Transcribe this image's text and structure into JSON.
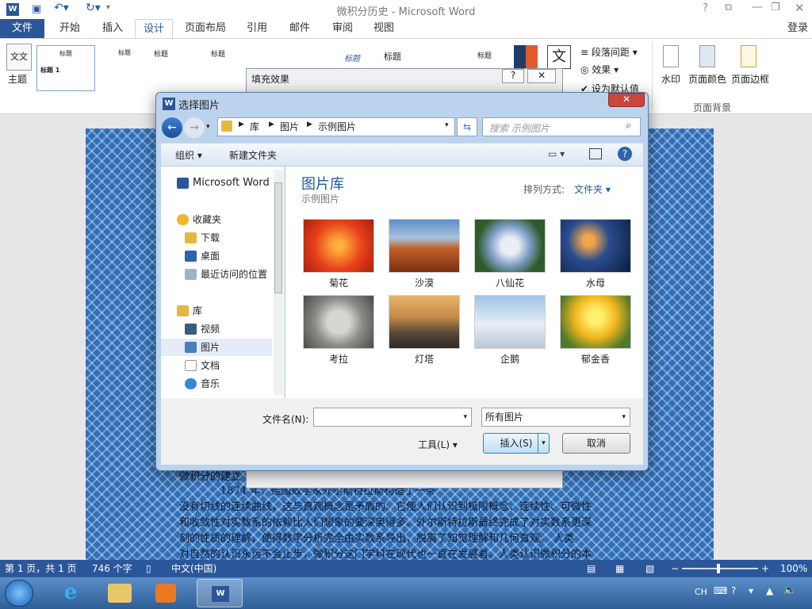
{
  "window": {
    "title": "微积分历史 - Microsoft Word",
    "signin": "登录"
  },
  "tabs": [
    {
      "label": "文件"
    },
    {
      "label": "开始"
    },
    {
      "label": "插入"
    },
    {
      "label": "设计"
    },
    {
      "label": "页面布局"
    },
    {
      "label": "引用"
    },
    {
      "label": "邮件"
    },
    {
      "label": "审阅"
    },
    {
      "label": "视图"
    }
  ],
  "ribbon": {
    "theme_label": "主题",
    "styles": [
      "标题",
      "标题 1",
      "标题",
      "标题",
      "标题",
      "标题",
      "标题",
      "标题"
    ],
    "paragraph_spacing": "段落间距",
    "effects": "效果",
    "set_default": "设为默认值",
    "watermark": "水印",
    "page_color": "页面颜色",
    "page_border": "页面边框",
    "group_page_bg": "页面背景"
  },
  "fill_dialog": {
    "title": "填充效果"
  },
  "dialog": {
    "title": "选择图片",
    "breadcrumb": [
      "库",
      "图片",
      "示例图片"
    ],
    "search_placeholder": "搜索 示例图片",
    "organize": "组织",
    "new_folder": "新建文件夹",
    "library_title": "图片库",
    "library_subtitle": "示例图片",
    "sort_label": "排列方式:",
    "sort_value": "文件夹",
    "nav": {
      "word": "Microsoft Word",
      "favorites": "收藏夹",
      "downloads": "下载",
      "desktop": "桌面",
      "recent": "最近访问的位置",
      "libraries": "库",
      "videos": "视频",
      "pictures": "图片",
      "documents": "文档",
      "music": "音乐"
    },
    "images": [
      {
        "label": "菊花"
      },
      {
        "label": "沙漠"
      },
      {
        "label": "八仙花"
      },
      {
        "label": "水母"
      },
      {
        "label": "考拉"
      },
      {
        "label": "灯塔"
      },
      {
        "label": "企鹅"
      },
      {
        "label": "郁金香"
      }
    ],
    "filename_label": "文件名(N):",
    "filename_value": "",
    "filetype": "所有图片",
    "tools": "工具(L)",
    "insert": "插入(S)",
    "cancel": "取消"
  },
  "doc": {
    "heading": "微积分的建立",
    "lines": [
      "1874 年，德国数学家外尔斯特拉斯构造了一条",
      "没有切线的连续曲线，这与直观概念是矛盾的。它使人们认识到极限概念、连续性、可微性",
      "和收敛性对实数系的依赖比人们想象的要深奥得多。外尔斯特拉斯最终完成了对实数系更深",
      "刻的性质的理解，使得数学分析完全由实数系导出，脱离了知觉理解和几何直观。  人类",
      "对自然的认识永远不会止步，微积分这门学科在现代也一直在发展着。人类认识微积分的本"
    ]
  },
  "status": {
    "page": "第 1 页，共 1 页",
    "words": "746 个字",
    "lang": "中文(中国)",
    "zoom": "100%"
  },
  "taskbar": {
    "ime": "CH"
  }
}
